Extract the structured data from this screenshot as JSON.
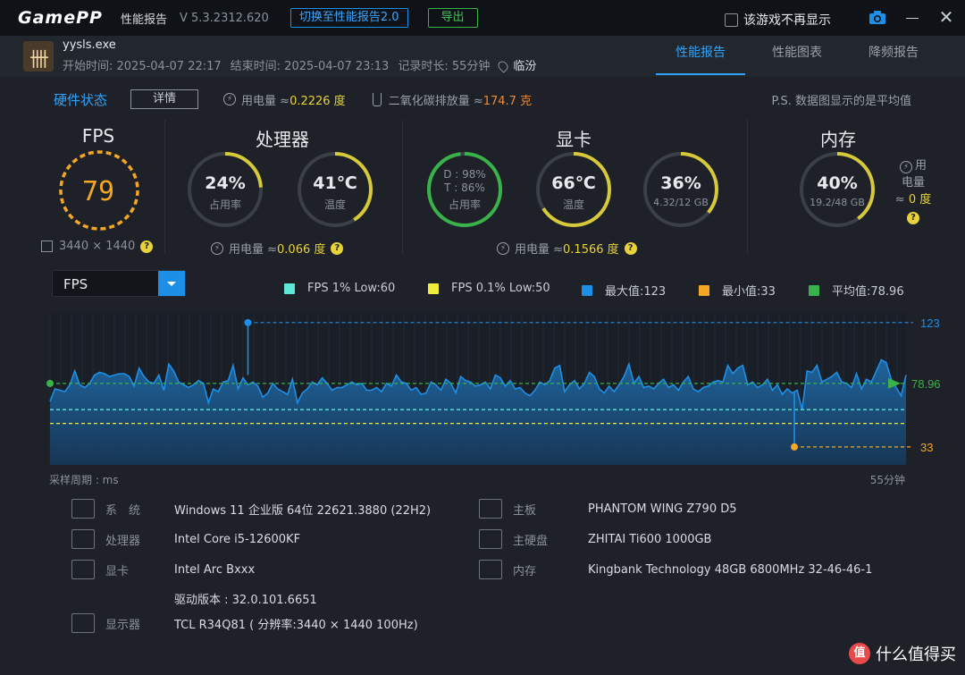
{
  "title_bar": {
    "logo": "GamePP",
    "app_name": "性能报告",
    "version": "V 5.3.2312.620",
    "switch_button": "切换至性能报告2.0",
    "export_button": "导出",
    "hide_label": "该游戏不再显示"
  },
  "game": {
    "exe": "yysls.exe",
    "start": "开始时间: 2025-04-07 22:17",
    "end": "结束时间: 2025-04-07 23:13",
    "duration": "记录时长: 55分钟",
    "location": "临汾"
  },
  "tabs": [
    "性能报告",
    "性能图表",
    "降频报告"
  ],
  "hardware": {
    "title": "硬件状态",
    "detail_button": "详情",
    "power_label": "用电量 ≈ ",
    "power_value": "0.2226 度",
    "co2_label": "二氧化碳排放量 ≈ ",
    "co2_value": "174.7 克",
    "note": "P.S. 数据图显示的是平均值"
  },
  "fps": {
    "head": "FPS",
    "value": "79",
    "resolution": "3440 × 1440"
  },
  "cpu": {
    "head": "处理器",
    "usage": "24%",
    "usage_label": "占用率",
    "usage_frac": 0.24,
    "temp": "41℃",
    "temp_label": "温度",
    "temp_frac": 0.41,
    "power_label": "用电量 ≈ ",
    "power_value": "0.066 度"
  },
  "gpu": {
    "head": "显卡",
    "d_line": "D : 98%",
    "t_line": "T : 86%",
    "usage_label": "占用率",
    "usage_frac": 0.98,
    "temp": "66℃",
    "temp_label": "温度",
    "temp_frac": 0.66,
    "vram": "36%",
    "vram_label": "4.32/12 GB",
    "vram_frac": 0.36,
    "power_label": "用电量 ≈ ",
    "power_value": "0.1566 度"
  },
  "memory": {
    "head": "内存",
    "usage": "40%",
    "usage_label": "19.2/48 GB",
    "usage_frac": 0.4,
    "power_line1": "用",
    "power_line2": "电量",
    "power_line3": "≈ ",
    "power_value": "0 度"
  },
  "chart_controls": {
    "selected": "FPS",
    "legend": [
      {
        "label": "FPS 1% Low:60",
        "color": "#5ee8d8"
      },
      {
        "label": "FPS 0.1% Low:50",
        "color": "#f2ec3a"
      },
      {
        "label": "最大值:123",
        "color": "#1e8fe6"
      },
      {
        "label": "最小值:33",
        "color": "#f5a623"
      },
      {
        "label": "平均值:78.96",
        "color": "#3ab24a"
      }
    ],
    "x_left": "采样周期 : ms",
    "x_right": "55分钟"
  },
  "chart_data": {
    "type": "line",
    "title": "",
    "xlabel": "采样周期 : ms",
    "ylabel": "",
    "x_end_label": "55分钟",
    "series": [
      {
        "name": "FPS",
        "color": "#1e8fe6",
        "values": [
          66,
          75,
          74,
          73,
          78,
          88,
          78,
          76,
          79,
          85,
          87,
          86,
          84,
          85,
          86,
          86,
          84,
          77,
          90,
          84,
          80,
          79,
          85,
          74,
          93,
          88,
          80,
          78,
          76,
          78,
          81,
          79,
          65,
          75,
          73,
          80,
          81,
          92,
          75,
          83,
          78,
          80,
          77,
          69,
          72,
          79,
          75,
          73,
          71,
          82,
          65,
          72,
          75,
          80,
          78,
          83,
          79,
          74,
          76,
          76,
          78,
          80,
          78,
          79,
          74,
          74,
          76,
          73,
          79,
          77,
          85,
          80,
          79,
          74,
          76,
          71,
          72,
          80,
          78,
          74,
          82,
          79,
          72,
          84,
          81,
          80,
          77,
          78,
          80,
          75,
          85,
          83,
          77,
          81,
          75,
          76,
          72,
          70,
          74,
          80,
          78,
          81,
          90,
          92,
          73,
          78,
          81,
          75,
          79,
          87,
          84,
          75,
          72,
          77,
          73,
          78,
          84,
          93,
          79,
          84,
          76,
          77,
          75,
          79,
          82,
          76,
          78,
          74,
          80,
          84,
          75,
          73,
          76,
          77,
          80,
          81,
          80,
          92,
          86,
          90,
          92,
          78,
          80,
          76,
          78,
          82,
          74,
          78,
          71,
          75,
          72,
          74,
          60,
          88,
          87,
          92,
          80,
          82,
          84,
          87,
          80,
          79,
          76,
          86,
          75,
          82,
          80,
          88,
          96,
          94,
          82,
          76,
          70,
          85
        ]
      }
    ],
    "max": 123,
    "min": 33,
    "average": 78.96,
    "fps_1pct_low": 60,
    "fps_01pct_low": 50,
    "ylim": [
      20,
      130
    ]
  },
  "system": {
    "os_key": "系　统",
    "os": "Windows 11 企业版 64位 22621.3880 (22H2)",
    "cpu_key": "处理器",
    "cpu": "Intel Core i5-12600KF",
    "gpu_key": "显卡",
    "gpu": "Intel Arc Bxxx",
    "driver": "驱动版本 : 32.0.101.6651",
    "monitor_key": "显示器",
    "monitor": "TCL R34Q81 ( 分辨率:3440 × 1440 100Hz)",
    "board_key": "主板",
    "board": "PHANTOM WING Z790 D5",
    "disk_key": "主硬盘",
    "disk": "ZHITAI Ti600 1000GB",
    "ram_key": "内存",
    "ram": "Kingbank Technology 48GB 6800MHz 32-46-46-1"
  },
  "watermark": "什么值得买"
}
